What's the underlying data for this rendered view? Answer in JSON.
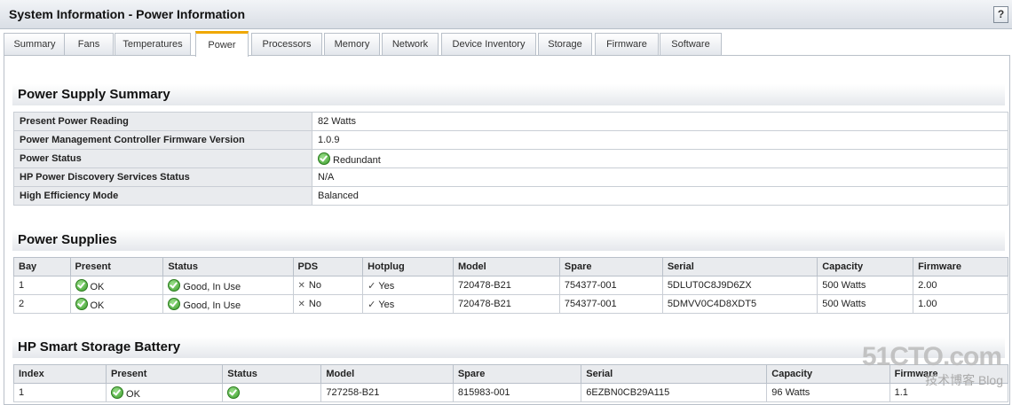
{
  "window": {
    "title": "System Information - Power Information",
    "help": "?"
  },
  "tabs": [
    "Summary",
    "Fans",
    "Temperatures",
    "Power",
    "Processors",
    "Memory",
    "Network",
    "Device Inventory",
    "Storage",
    "Firmware",
    "Software"
  ],
  "active_tab": "Power",
  "summary": {
    "heading": "Power Supply Summary",
    "rows": [
      {
        "key": "Present Power Reading",
        "value": "82 Watts",
        "icon": ""
      },
      {
        "key": "Power Management Controller Firmware Version",
        "value": "1.0.9",
        "icon": ""
      },
      {
        "key": "Power Status",
        "value": "Redundant",
        "icon": "ok-icon"
      },
      {
        "key": "HP Power Discovery Services Status",
        "value": "N/A",
        "icon": ""
      },
      {
        "key": "High Efficiency Mode",
        "value": "Balanced",
        "icon": ""
      }
    ]
  },
  "supplies": {
    "heading": "Power Supplies",
    "columns": [
      "Bay",
      "Present",
      "Status",
      "PDS",
      "Hotplug",
      "Model",
      "Spare",
      "Serial",
      "Capacity",
      "Firmware"
    ],
    "rows": [
      [
        "1",
        "OK",
        "Good, In Use",
        "No",
        "Yes",
        "720478-B21",
        "754377-001",
        "5DLUT0C8J9D6ZX",
        "500 Watts",
        "2.00"
      ],
      [
        "2",
        "OK",
        "Good, In Use",
        "No",
        "Yes",
        "720478-B21",
        "754377-001",
        "5DMVV0C4D8XDT5",
        "500 Watts",
        "1.00"
      ]
    ]
  },
  "battery": {
    "heading": "HP Smart Storage Battery",
    "columns": [
      "Index",
      "Present",
      "Status",
      "Model",
      "Spare",
      "Serial",
      "Capacity",
      "Firmware"
    ],
    "rows": [
      [
        "1",
        "OK",
        "",
        "727258-B21",
        "815983-001",
        "6EZBN0CB29A115",
        "96 Watts",
        "1.1"
      ]
    ]
  },
  "watermark": {
    "main": "51CTO.com",
    "sub": "技术博客  Blog"
  }
}
